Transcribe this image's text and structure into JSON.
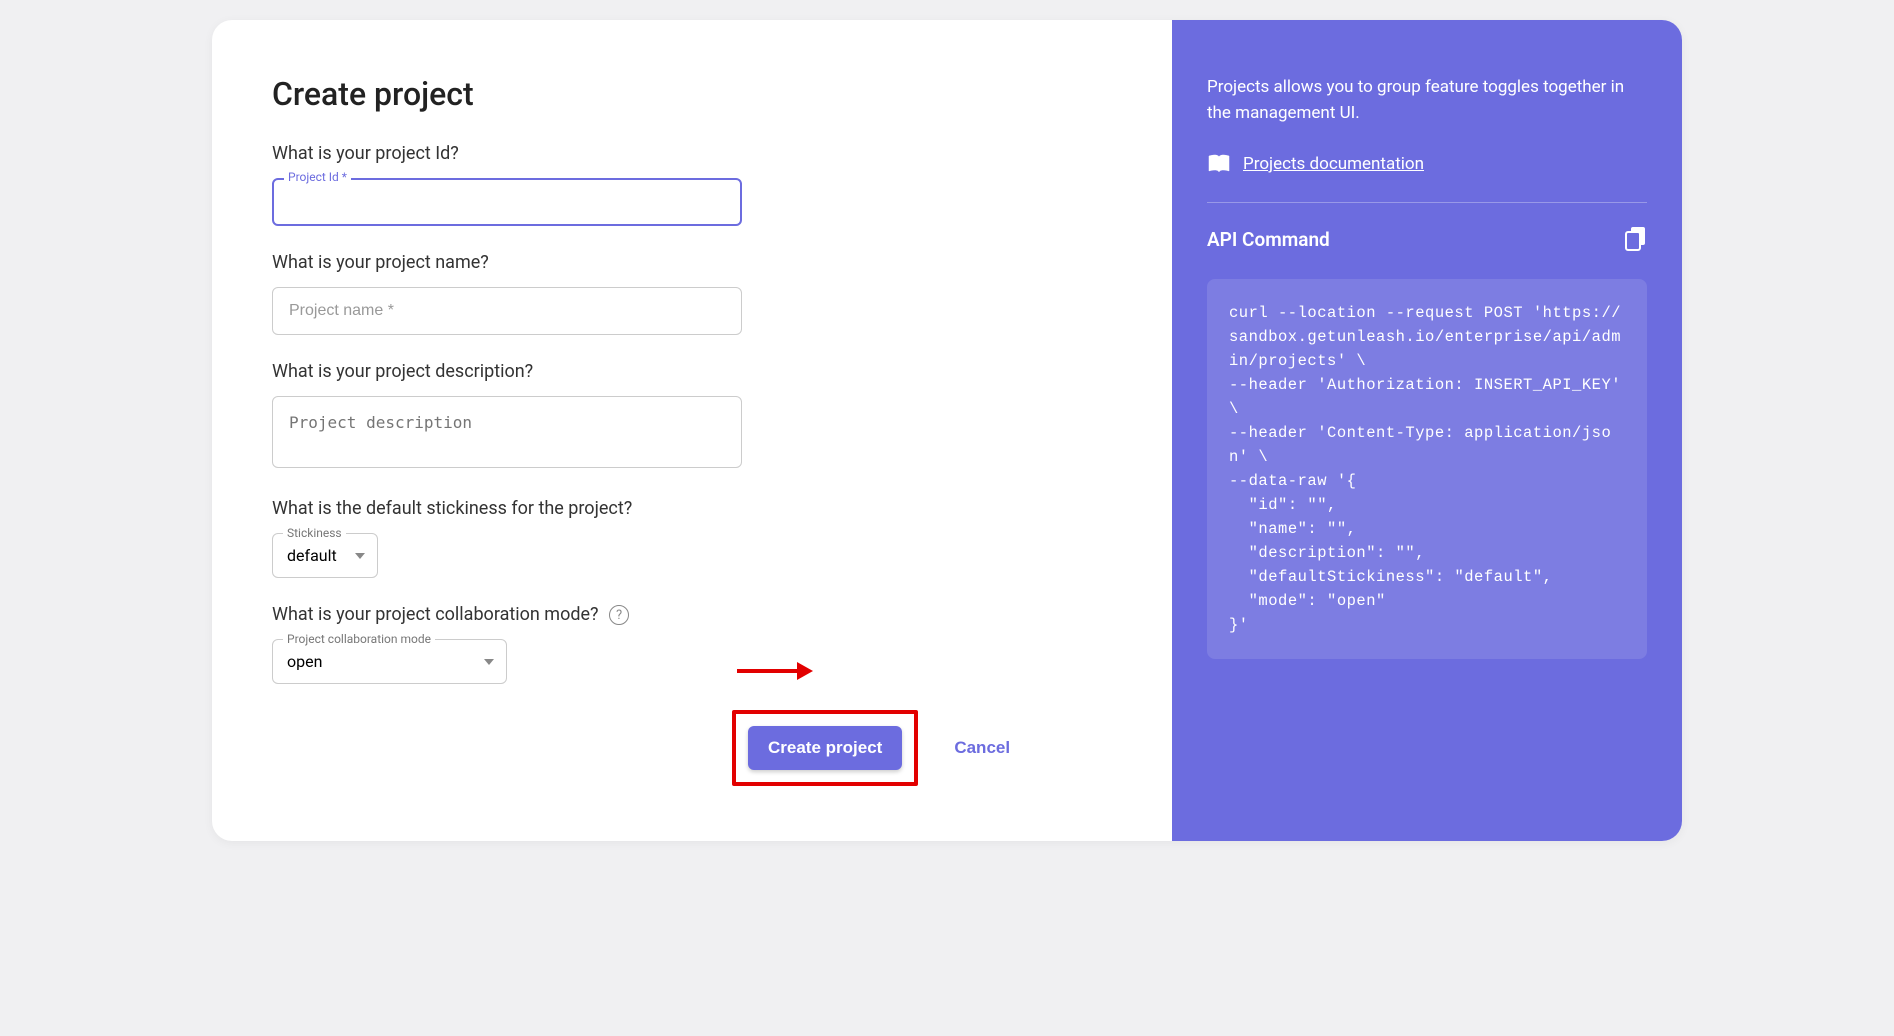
{
  "title": "Create project",
  "fields": {
    "id": {
      "question": "What is your project Id?",
      "label": "Project Id *",
      "value": ""
    },
    "name": {
      "question": "What is your project name?",
      "placeholder": "Project name *",
      "value": ""
    },
    "description": {
      "question": "What is your project description?",
      "placeholder": "Project description",
      "value": ""
    },
    "stickiness": {
      "question": "What is the default stickiness for the project?",
      "label": "Stickiness",
      "value": "default"
    },
    "collab": {
      "question": "What is your project collaboration mode?",
      "label": "Project collaboration mode",
      "value": "open"
    }
  },
  "actions": {
    "primary": "Create project",
    "cancel": "Cancel"
  },
  "sidebar": {
    "info": "Projects allows you to group feature toggles together in the management UI.",
    "doc_link": "Projects documentation",
    "api_title": "API Command",
    "code": "curl --location --request POST 'https://sandbox.getunleash.io/enterprise/api/admin/projects' \\\n--header 'Authorization: INSERT_API_KEY' \\\n--header 'Content-Type: application/json' \\\n--data-raw '{\n  \"id\": \"\",\n  \"name\": \"\",\n  \"description\": \"\",\n  \"defaultStickiness\": \"default\",\n  \"mode\": \"open\"\n}'"
  }
}
